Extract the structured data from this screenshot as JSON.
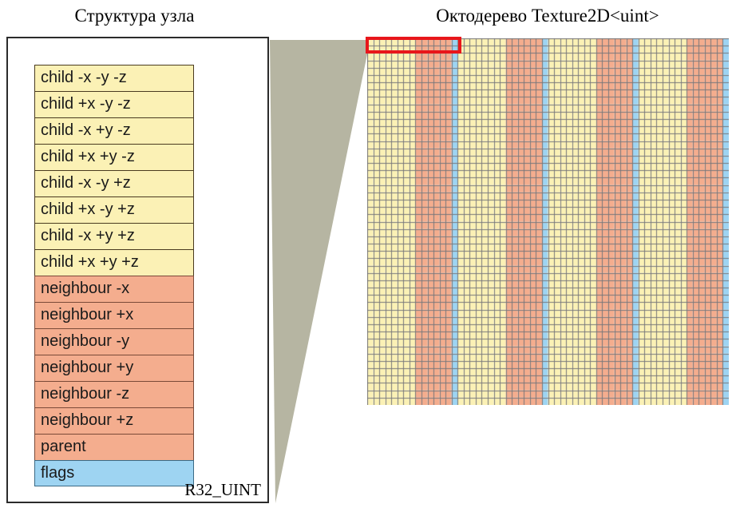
{
  "titles": {
    "left": "Структура узла",
    "right": "Октодерево Texture2D<uint>"
  },
  "node_structure": {
    "format_label": "R32_UINT",
    "fields": [
      {
        "label": "child -x -y -z",
        "kind": "child"
      },
      {
        "label": "child +x -y -z",
        "kind": "child"
      },
      {
        "label": "child -x +y -z",
        "kind": "child"
      },
      {
        "label": "child +x +y -z",
        "kind": "child"
      },
      {
        "label": "child -x -y +z",
        "kind": "child"
      },
      {
        "label": "child +x -y +z",
        "kind": "child"
      },
      {
        "label": "child -x +y +z",
        "kind": "child"
      },
      {
        "label": "child +x +y +z",
        "kind": "child"
      },
      {
        "label": "neighbour  -x",
        "kind": "neighbour"
      },
      {
        "label": "neighbour +x",
        "kind": "neighbour"
      },
      {
        "label": "neighbour  -y",
        "kind": "neighbour"
      },
      {
        "label": "neighbour +y",
        "kind": "neighbour"
      },
      {
        "label": "neighbour  -z",
        "kind": "neighbour"
      },
      {
        "label": "neighbour +z",
        "kind": "neighbour"
      },
      {
        "label": "parent",
        "kind": "neighbour"
      },
      {
        "label": "flags",
        "kind": "flags"
      }
    ]
  },
  "texture": {
    "columns": 60,
    "rows": 50,
    "cell_width": 7.55,
    "cell_height": 9.18,
    "node_pattern": {
      "child_cells": 8,
      "neighbour_parent_cells": 6,
      "flags_cells": 1
    },
    "highlight_cells": 15
  },
  "colors": {
    "child": "#fbf1b5",
    "neighbour": "#f4ad8e",
    "flags": "#9ed4f2",
    "gridline": "#77777a",
    "highlight": "#e8161b",
    "connector": "#b6b5a2",
    "box_border": "#2b2b2b"
  }
}
